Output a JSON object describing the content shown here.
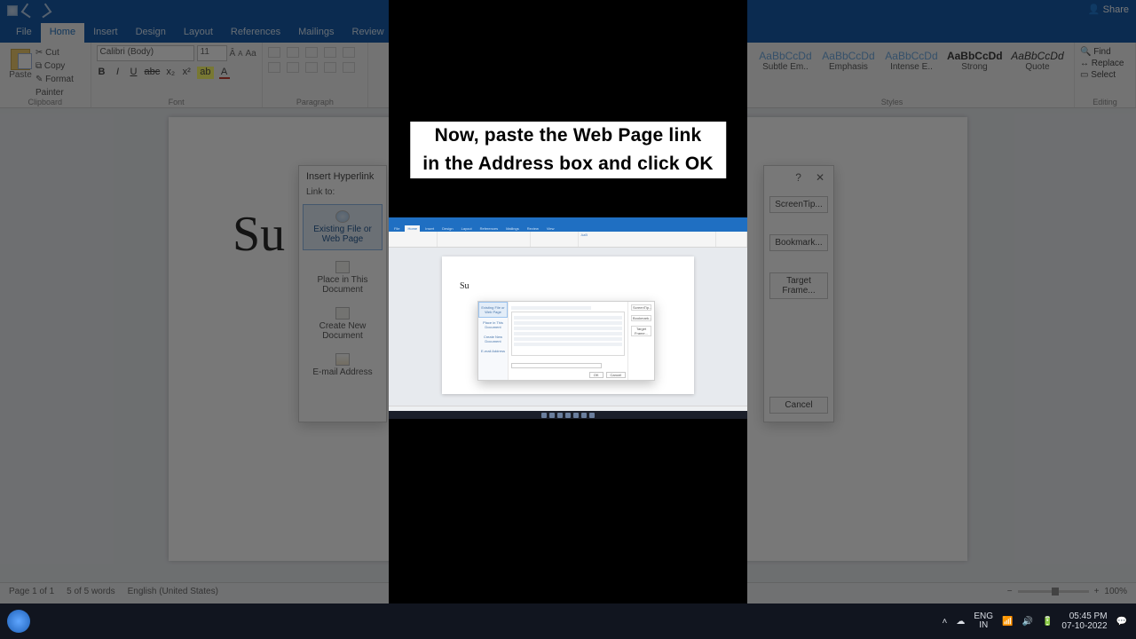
{
  "caption": {
    "line1": "Now, paste the Web Page link",
    "line2": "in the Address box and click OK"
  },
  "word_bg": {
    "share": "Share",
    "tabs": [
      "File",
      "Home",
      "Insert",
      "Design",
      "Layout",
      "References",
      "Mailings",
      "Review",
      "Vi"
    ],
    "active_tab": "Home",
    "clipboard": {
      "cut": "Cut",
      "copy": "Copy",
      "painter": "Format Painter",
      "paste": "Paste",
      "label": "Clipboard"
    },
    "font": {
      "family_value": "Calibri (Body)",
      "size_value": "11",
      "label": "Font",
      "buttons": [
        "B",
        "I",
        "U",
        "abc",
        "x₂",
        "x²",
        "A",
        "A"
      ]
    },
    "paragraph_label": "Paragraph",
    "styles_label": "Styles",
    "styles": [
      {
        "name": "Subtle Em..",
        "preview": "AaBbCcDd"
      },
      {
        "name": "Emphasis",
        "preview": "AaBbCcDd"
      },
      {
        "name": "Intense E..",
        "preview": "AaBbCcDd"
      },
      {
        "name": "Strong",
        "preview": "AaBbCcDd"
      },
      {
        "name": "Quote",
        "preview": "AaBbCcDd"
      }
    ],
    "editing": {
      "find": "Find",
      "replace": "Replace",
      "select": "Select",
      "label": "Editing"
    },
    "heading": "Su",
    "status": {
      "page": "Page 1 of 1",
      "words": "5 of 5 words",
      "lang": "English (United States)",
      "zoom": "100%"
    }
  },
  "dialog_bg": {
    "title": "Insert Hyperlink",
    "link_to": "Link to:",
    "nav": [
      "Existing File or Web Page",
      "Place in This Document",
      "Create New Document",
      "E-mail Address"
    ],
    "help": "?",
    "close": "✕",
    "screentip": "ScreenTip...",
    "bookmark": "Bookmark...",
    "target": "Target Frame...",
    "cancel": "Cancel"
  },
  "taskbar": {
    "lang1": "ENG",
    "lang2": "IN",
    "time": "05:45 PM",
    "date": "07-10-2022"
  },
  "inner": {
    "tabs": [
      "File",
      "Home",
      "Insert",
      "Design",
      "Layout",
      "References",
      "Mailings",
      "Review",
      "View",
      "Tell me what you want to do"
    ],
    "heading": "Su",
    "dialog_nav": [
      "Existing File or Web Page",
      "Place in This Document",
      "Create New Document",
      "E-mail Address"
    ],
    "ok": "OK",
    "cancel": "Cancel",
    "screentip": "ScreenTip...",
    "bookmark": "Bookmark...",
    "target": "Target Frame..."
  }
}
